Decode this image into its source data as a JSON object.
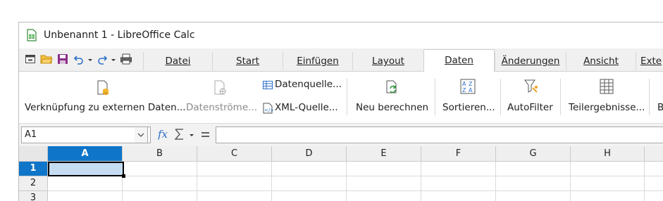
{
  "window": {
    "title": "Unbenannt 1 - LibreOffice Calc"
  },
  "quick_access": [
    "new-document-icon",
    "open-folder-icon",
    "save-icon",
    "undo-icon",
    "redo-icon",
    "print-icon"
  ],
  "tabs": [
    {
      "label": "Datei",
      "active": false
    },
    {
      "label": "Start",
      "active": false
    },
    {
      "label": "Einfügen",
      "active": false
    },
    {
      "label": "Layout",
      "active": false
    },
    {
      "label": "Daten",
      "active": true
    },
    {
      "label": "Änderungen",
      "active": false
    },
    {
      "label": "Ansicht",
      "active": false
    },
    {
      "label": "Exte",
      "active": false
    }
  ],
  "ribbon": {
    "link_external": "Verknüpfung zu externen Daten...",
    "data_streams": "Datenströme...",
    "data_source": "Datenquelle...",
    "xml_source": "XML-Quelle...",
    "recalculate": "Neu berechnen",
    "sort": "Sortieren...",
    "autofilter": "AutoFilter",
    "subtotals": "Teilergebnisse...",
    "cut_off": "B"
  },
  "formula_bar": {
    "name_box": "A1",
    "input_value": ""
  },
  "grid": {
    "columns": [
      "A",
      "B",
      "C",
      "D",
      "E",
      "F",
      "G",
      "H"
    ],
    "rows": [
      "1",
      "2",
      "3"
    ],
    "selected_cell": "A1"
  },
  "colors": {
    "selection_header": "#0f75c8",
    "active_cell_fill": "#c6dcf2",
    "save_icon": "#8b2f8b"
  }
}
